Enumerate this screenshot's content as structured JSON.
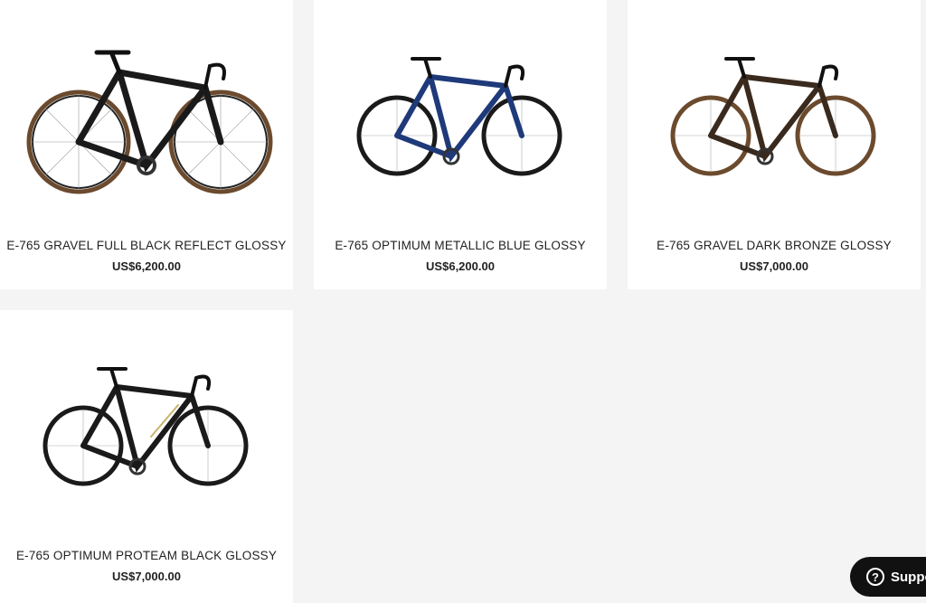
{
  "products": [
    {
      "name": "E-765 GRAVEL FULL BLACK REFLECT GLOSSY",
      "price": "US$6,200.00",
      "accent": "#2a2a2a",
      "tire": "#6b4a2e"
    },
    {
      "name": "E-765 OPTIMUM METALLIC BLUE GLOSSY",
      "price": "US$6,200.00",
      "accent": "#1f3a7a",
      "tire": "#1a1a1a"
    },
    {
      "name": "E-765 GRAVEL DARK BRONZE GLOSSY",
      "price": "US$7,000.00",
      "accent": "#5a3a22",
      "tire": "#6b4a2e"
    },
    {
      "name": "E-765 OPTIMUM PROTEAM BLACK GLOSSY",
      "price": "US$7,000.00",
      "accent": "#222222",
      "tire": "#1a1a1a"
    }
  ],
  "support": {
    "label": "Suppo",
    "icon": "question-icon"
  }
}
